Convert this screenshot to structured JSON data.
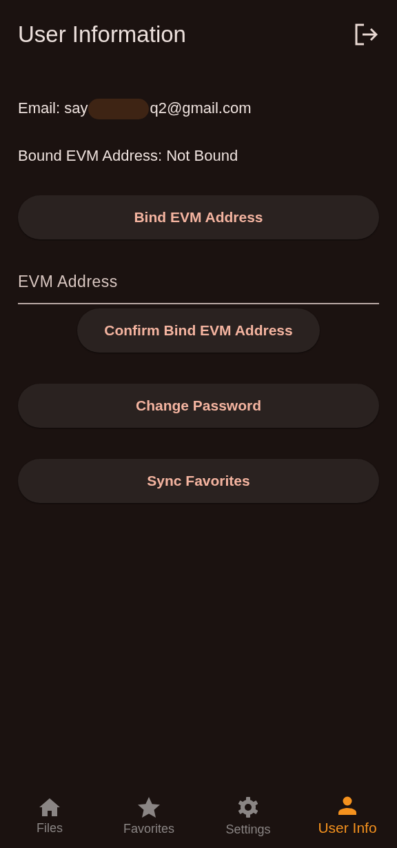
{
  "app_bar": {
    "title": "User Information"
  },
  "email": {
    "prefix": "Email: say",
    "redacted": true,
    "suffix": "q2@gmail.com"
  },
  "bound_address": "Bound EVM Address: Not Bound",
  "bind_button": "Bind EVM Address",
  "address_field": {
    "placeholder": "EVM Address"
  },
  "confirm_button": "Confirm Bind EVM Address",
  "actions": [
    "Change Password",
    "Sync Favorites"
  ],
  "nav": [
    {
      "label": "Files",
      "kind": "home",
      "selected": false
    },
    {
      "label": "Favorites",
      "kind": "star",
      "selected": false
    },
    {
      "label": "Settings",
      "kind": "gear",
      "selected": false
    },
    {
      "label": "User Info",
      "kind": "person",
      "selected": true
    }
  ]
}
